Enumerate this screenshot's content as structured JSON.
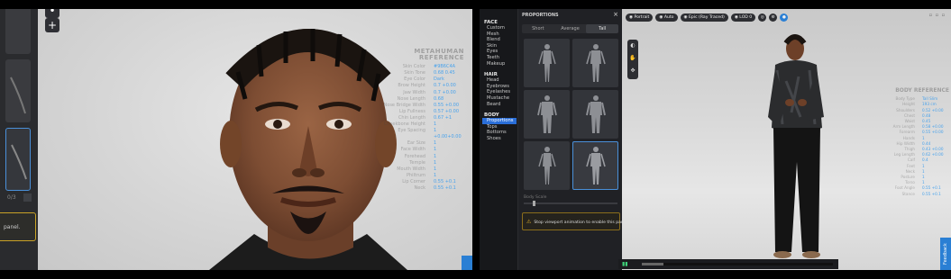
{
  "left": {
    "nav_page": "0/3",
    "panel_note": "panel.",
    "reference": {
      "title": "METAHUMAN REFERENCE",
      "rows": [
        {
          "k": "Skin Color",
          "v": "#9B6C4A"
        },
        {
          "k": "Skin Tone",
          "v": "0.68 0.45"
        },
        {
          "k": "Eye Color",
          "v": "Dark"
        },
        {
          "k": "Brow Height",
          "v": "0.7 +0.00"
        },
        {
          "k": "Jaw Width",
          "v": "0.7 +0.00"
        },
        {
          "k": "Nose Length",
          "v": "0.68"
        },
        {
          "k": "Nose Bridge Width",
          "v": "0.55 +0.00"
        },
        {
          "k": "Lip Fullness",
          "v": "0.57 +0.00"
        },
        {
          "k": "Chin Length",
          "v": "0.67 +1"
        },
        {
          "k": "Cheekbone Height",
          "v": "1"
        },
        {
          "k": "Eye Spacing",
          "v": "1 +0.00+0.00"
        },
        {
          "k": "Ear Size",
          "v": "1"
        },
        {
          "k": "Face Width",
          "v": "1"
        },
        {
          "k": "Forehead",
          "v": "1"
        },
        {
          "k": "Temple",
          "v": "1"
        },
        {
          "k": "Mouth Width",
          "v": "1"
        },
        {
          "k": "Philtrum",
          "v": "1"
        },
        {
          "k": "Lip Corner",
          "v": "0.55 +0.1"
        },
        {
          "k": "Neck",
          "v": "0.55 +0.1"
        }
      ]
    }
  },
  "right": {
    "categories": [
      {
        "heading": "FACE",
        "items": [
          "Custom Mesh",
          "Blend",
          "Skin",
          "Eyes",
          "Teeth",
          "Makeup"
        ]
      },
      {
        "heading": "HAIR",
        "items": [
          "Head",
          "Eyebrows",
          "Eyelashes",
          "Mustache",
          "Beard"
        ]
      },
      {
        "heading": "BODY",
        "items": [
          "Proportions",
          "Tops",
          "Bottoms",
          "Shoes"
        ]
      }
    ],
    "selected_category_item": "Proportions",
    "panel_title": "PROPORTIONS",
    "height_options": [
      "Short",
      "Average",
      "Tall"
    ],
    "selected_height": "Tall",
    "body_size_label": "Body Scale",
    "warning": "Stop viewport animation to enable this panel.",
    "topbar": {
      "portrait": "Portrait",
      "auto": "Auto",
      "quality": "Epic (Ray Traced)",
      "lod": "LOD 0"
    },
    "feedback_label": "Feedback",
    "reference": {
      "title": "BODY REFERENCE",
      "rows": [
        {
          "k": "Body Type",
          "v": "Tall Slim"
        },
        {
          "k": "Height",
          "v": "193 cm"
        },
        {
          "k": "Shoulders",
          "v": "0.52 +0.00"
        },
        {
          "k": "Chest",
          "v": "0.48"
        },
        {
          "k": "Waist",
          "v": "0.45"
        },
        {
          "k": "Arm Length",
          "v": "0.58 +0.00"
        },
        {
          "k": "Forearm",
          "v": "0.55 +0.00"
        },
        {
          "k": "Hands",
          "v": "1"
        },
        {
          "k": "Hip Width",
          "v": "0.44"
        },
        {
          "k": "Thigh",
          "v": "0.43 +0.00"
        },
        {
          "k": "Leg Length",
          "v": "0.62 +0.00"
        },
        {
          "k": "Calf",
          "v": "0.4"
        },
        {
          "k": "Feet",
          "v": "1"
        },
        {
          "k": "Neck",
          "v": "1"
        },
        {
          "k": "Posture",
          "v": "1"
        },
        {
          "k": "Torso",
          "v": "1"
        },
        {
          "k": "Foot Angle",
          "v": "0.55 +0.1"
        },
        {
          "k": "Stance",
          "v": "0.55 +0.1"
        }
      ]
    }
  }
}
